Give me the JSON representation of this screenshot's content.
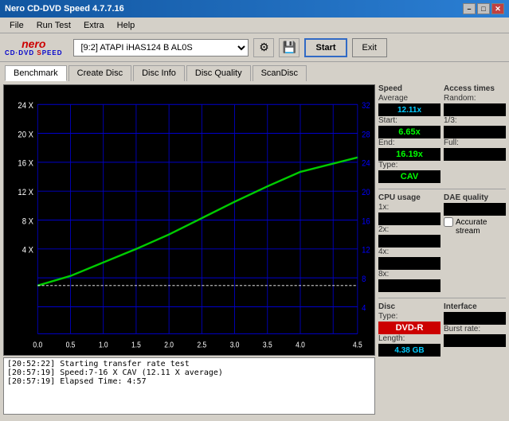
{
  "titlebar": {
    "title": "Nero CD-DVD Speed 4.7.7.16",
    "minimize": "–",
    "maximize": "□",
    "close": "✕"
  },
  "menubar": {
    "items": [
      "File",
      "Run Test",
      "Extra",
      "Help"
    ]
  },
  "toolbar": {
    "drive_value": "[9:2]  ATAPI iHAS124  B AL0S",
    "start_label": "Start",
    "exit_label": "Exit"
  },
  "tabs": {
    "items": [
      "Benchmark",
      "Create Disc",
      "Disc Info",
      "Disc Quality",
      "ScanDisc"
    ],
    "active": "Benchmark"
  },
  "speed_panel": {
    "title": "Speed",
    "average_label": "Average",
    "average_value": "12.11x",
    "start_label": "Start:",
    "start_value": "6.65x",
    "end_label": "End:",
    "end_value": "16.19x",
    "type_label": "Type:",
    "type_value": "CAV"
  },
  "access_panel": {
    "title": "Access times",
    "random_label": "Random:",
    "third_label": "1/3:",
    "full_label": "Full:"
  },
  "cpu_panel": {
    "title": "CPU usage",
    "x1_label": "1x:",
    "x2_label": "2x:",
    "x4_label": "4x:",
    "x8_label": "8x:"
  },
  "dae_panel": {
    "title": "DAE quality",
    "accurate_label": "Accurate",
    "stream_label": "stream"
  },
  "disc_panel": {
    "title": "Disc",
    "type_label": "Type:",
    "type_value": "DVD-R",
    "length_label": "Length:",
    "length_value": "4.38 GB"
  },
  "interface_panel": {
    "title": "Interface",
    "burst_label": "Burst rate:"
  },
  "chart": {
    "y_left_labels": [
      "24 X",
      "20 X",
      "16 X",
      "12 X",
      "8 X",
      "4 X"
    ],
    "y_right_labels": [
      "32",
      "28",
      "24",
      "20",
      "16",
      "12",
      "8",
      "4"
    ],
    "x_labels": [
      "0.0",
      "0.5",
      "1.0",
      "1.5",
      "2.0",
      "2.5",
      "3.0",
      "3.5",
      "4.0",
      "4.5"
    ]
  },
  "log": {
    "entries": [
      "[20:52:22]  Starting transfer rate test",
      "[20:57:19]  Speed:7-16 X CAV (12.11 X average)",
      "[20:57:19]  Elapsed Time: 4:57"
    ]
  }
}
